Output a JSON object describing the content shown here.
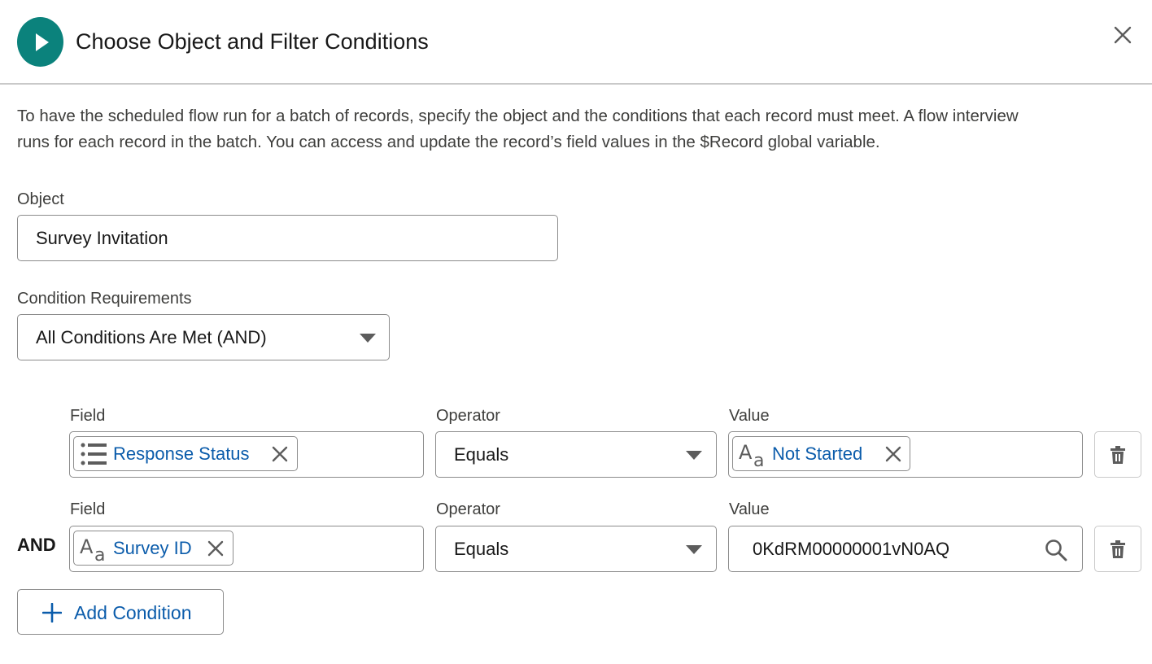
{
  "header": {
    "title": "Choose Object and Filter Conditions",
    "icon": "play-icon",
    "close_icon": "close-icon",
    "icon_color": "#0b827c"
  },
  "description": "To have the scheduled flow run for a batch of records, specify the object and the conditions that each record must meet. A flow interview runs for each record in the batch. You can access and update the record’s field values in the $Record global variable.",
  "description_lines": [
    "To have the scheduled flow run for a batch of records, specify the object and the conditions that each record must meet. A flow interview",
    "runs for each record in the batch. You can access and update the record’s field values in the $Record global variable."
  ],
  "object": {
    "label": "Object",
    "value": "Survey Invitation"
  },
  "condition_requirements": {
    "label": "Condition Requirements",
    "selected": "All Conditions Are Met (AND)"
  },
  "conditions": [
    {
      "connector": "",
      "field_label": "Field",
      "field_value": "Response Status",
      "field_icon": "picklist-icon",
      "operator_label": "Operator",
      "operator_value": "Equals",
      "value_label": "Value",
      "value": "Not Started",
      "value_icon": "text-type-icon"
    },
    {
      "connector": "AND",
      "field_label": "Field",
      "field_value": "Survey ID",
      "field_icon": "text-type-icon",
      "operator_label": "Operator",
      "operator_value": "Equals",
      "value_label": "Value",
      "value": "0KdRM00000001vN0AQ",
      "value_icon": "search-icon"
    }
  ],
  "add_condition": {
    "label": "Add Condition",
    "icon": "plus-icon"
  },
  "colors": {
    "link": "#0b5cab",
    "accent": "#0b827c",
    "border": "#8c8c8c"
  }
}
